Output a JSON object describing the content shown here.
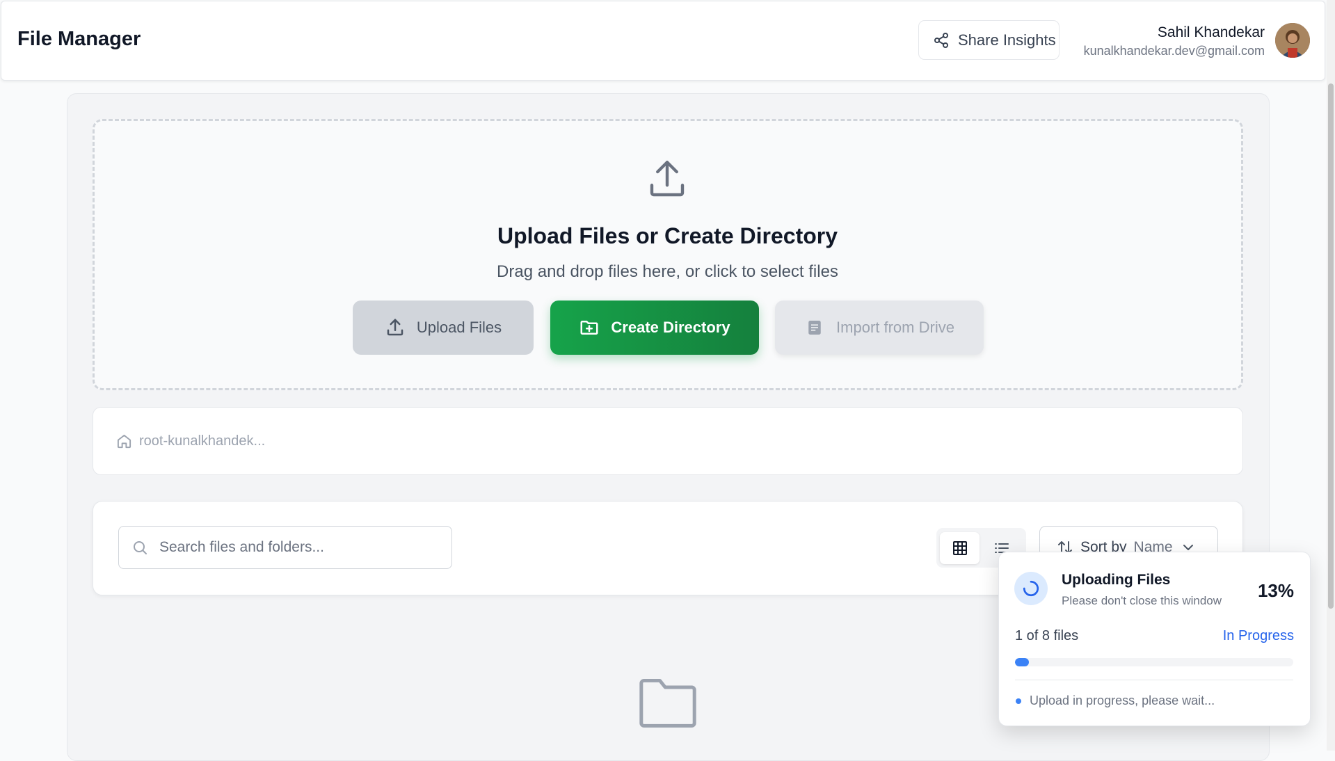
{
  "header": {
    "title": "File Manager",
    "share_label": "Share Insights",
    "user": {
      "name": "Sahil Khandekar",
      "email": "kunalkhandekar.dev@gmail.com"
    }
  },
  "upload": {
    "title": "Upload Files or Create Directory",
    "subtitle": "Drag and drop files here, or click to select files",
    "buttons": {
      "upload": "Upload Files",
      "create": "Create Directory",
      "import": "Import from Drive"
    }
  },
  "breadcrumb": {
    "root": "root-kunalkhandek..."
  },
  "toolbar": {
    "search_placeholder": "Search files and folders...",
    "sort_label": "Sort by",
    "sort_value": "Name",
    "view_mode": "grid"
  },
  "upload_status": {
    "title": "Uploading Files",
    "subtitle": "Please don't close this window",
    "percent_label": "13%",
    "progress": 0.05,
    "count": "1 of 8 files",
    "status": "In Progress",
    "note": "Upload in progress, please wait..."
  },
  "colors": {
    "primary_green": "#16a34a",
    "accent_blue": "#3b82f6",
    "status_blue": "#2563eb"
  }
}
